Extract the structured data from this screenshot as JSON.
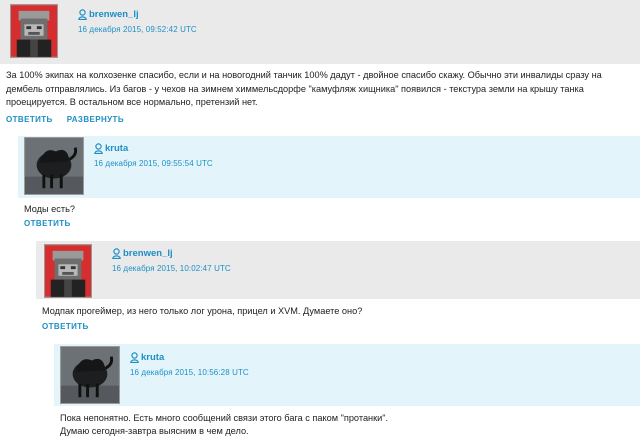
{
  "colors": {
    "header_gray": "#eaeaea",
    "header_blue": "#e4f4fb",
    "link": "#1d8fc4",
    "text": "#222222"
  },
  "comments": [
    {
      "username": "brenwen_lj",
      "user_icon": "user-icon",
      "avatar": "avatar-portrait-red",
      "date": "16 декабря 2015, 09:52:42 UTC",
      "text": "За 100% экипах на колхозенке спасибо, если и на новогодний танчик 100% дадут - двойное спасибо скажу. Обычно эти инвалиды сразу на дембель отправлялись. Из багов - у чехов на зимнем химмельсдорфе \"камуфляж хищника\" появился - текстура земли на крышу танка проецируется. В остальном все нормально, претензий нет.",
      "actions": [
        "ОТВЕТИТЬ",
        "РАЗВЕРНУТЬ"
      ]
    },
    {
      "username": "kruta",
      "user_icon": "user-icon",
      "avatar": "avatar-dark-cat",
      "date": "16 декабря 2015, 09:55:54 UTC",
      "text": "Моды есть?",
      "actions": [
        "ОТВЕТИТЬ"
      ]
    },
    {
      "username": "brenwen_lj",
      "user_icon": "user-icon",
      "avatar": "avatar-portrait-red",
      "date": "16 декабря 2015, 10:02:47 UTC",
      "text": "Модпак прогеймер, из него только лог урона, прицел и XVM. Думаете оно?",
      "actions": [
        "ОТВЕТИТЬ"
      ]
    },
    {
      "username": "kruta",
      "user_icon": "user-icon",
      "avatar": "avatar-dark-cat",
      "date": "16 декабря 2015, 10:56:28 UTC",
      "text_lines": [
        "Пока непонятно. Есть много сообщений связи этого бага с паком \"протанки\".",
        "Думаю сегодня-завтра выясним в чем дело."
      ]
    }
  ]
}
